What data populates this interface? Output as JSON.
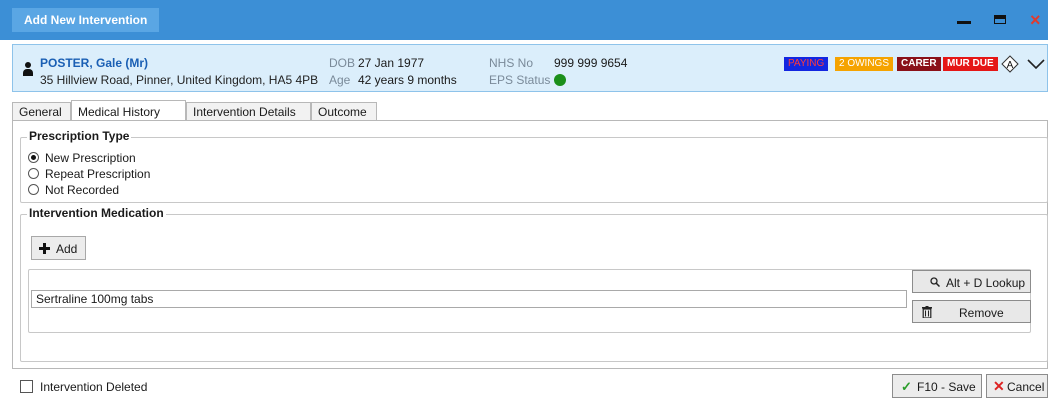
{
  "window": {
    "title": "Add New Intervention",
    "close_glyph": "×",
    "accent_color": "#3c8fd6"
  },
  "patient": {
    "name": "POSTER, Gale (Mr)",
    "address": "35 Hillview Road, Pinner, United Kingdom, HA5 4PB",
    "dob_label": "DOB",
    "dob": "27 Jan 1977",
    "age_label": "Age",
    "age": "42 years 9 months",
    "nhs_label": "NHS No",
    "nhs_number": "999 999 9654",
    "eps_label": "EPS Status",
    "eps_status_color": "#1a8f1a",
    "badges": {
      "paying": "PAYING",
      "owings": "2 OWINGS",
      "carer": "CARER",
      "mur": "MUR DUE"
    },
    "alert_letter": "A"
  },
  "tabs": {
    "general": "General",
    "medical_history": "Medical History",
    "intervention_details": "Intervention Details",
    "outcome": "Outcome",
    "active": "Medical History"
  },
  "prescription_type": {
    "title": "Prescription Type",
    "options": [
      "New Prescription",
      "Repeat Prescription",
      "Not Recorded"
    ],
    "selected": "New Prescription"
  },
  "medication": {
    "title": "Intervention Medication",
    "add_label": "Add",
    "item_value": "Sertraline 100mg tabs",
    "lookup_label": "Alt + D Lookup",
    "remove_label": "Remove"
  },
  "footer": {
    "deleted_label": "Intervention Deleted",
    "deleted_checked": false,
    "save_label": "F10 - Save",
    "cancel_label": "Cancel",
    "check_glyph": "✓",
    "x_glyph": "✕"
  }
}
